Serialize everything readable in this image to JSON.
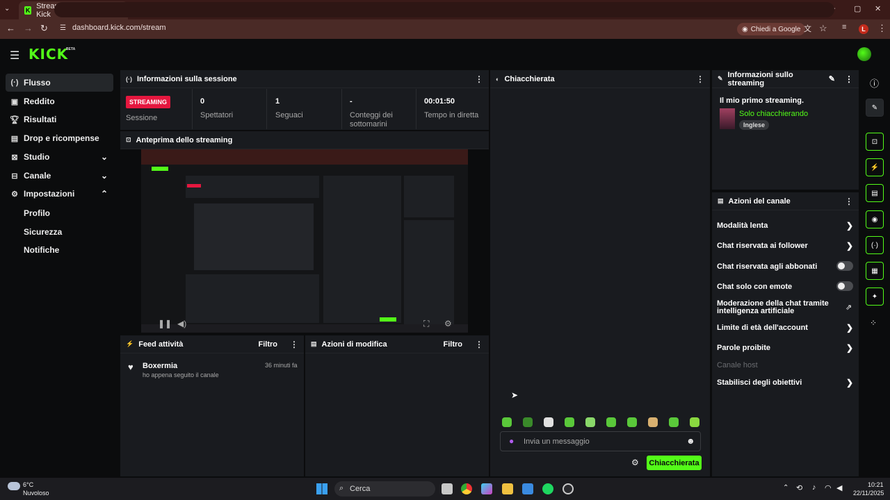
{
  "browser": {
    "tab_title": "Stream - Dashboard di Kick",
    "tab_close": "✕",
    "new_tab": "+",
    "url": "dashboard.kick.com/stream",
    "ask_google": "Chiedi a Google",
    "profile_initial": "L",
    "window_controls": [
      "–",
      "▢",
      "✕"
    ]
  },
  "kick": {
    "logo": "KICK",
    "beta": "BETA"
  },
  "sidebar": {
    "items": [
      {
        "label": "Flusso",
        "icon": "broadcast-icon"
      },
      {
        "label": "Reddito",
        "icon": "wallet-icon"
      },
      {
        "label": "Risultati",
        "icon": "trophy-icon"
      },
      {
        "label": "Drop e ricompense",
        "icon": "gift-icon"
      },
      {
        "label": "Studio",
        "icon": "studio-icon"
      },
      {
        "label": "Canale",
        "icon": "channel-icon"
      },
      {
        "label": "Impostazioni",
        "icon": "gear-icon"
      }
    ],
    "sub_items": [
      "Profilo",
      "Sicurezza",
      "Notifiche"
    ]
  },
  "session": {
    "title": "Informazioni sulla sessione",
    "badge": "STREAMING",
    "badge_label": "Sessione",
    "stats": [
      {
        "value": "0",
        "label": "Spettatori"
      },
      {
        "value": "1",
        "label": "Seguaci"
      },
      {
        "value": "-",
        "label": "Conteggi dei sottomarini"
      },
      {
        "value": "00:01:50",
        "label": "Tempo in diretta"
      }
    ]
  },
  "preview": {
    "title": "Anteprima dello streaming"
  },
  "feed": {
    "title": "Feed attività",
    "filter": "Filtro",
    "items": [
      {
        "user": "Boxermia",
        "time": "36 minuti fa",
        "text": "ho appena seguito il canale"
      }
    ]
  },
  "mod": {
    "title": "Azioni di modifica",
    "filter": "Filtro"
  },
  "chat": {
    "title": "Chiacchierata",
    "placeholder": "Invia un messaggio",
    "send": "Chiacchierata"
  },
  "stream_info": {
    "title": "Informazioni sullo streaming",
    "stream_title": "Il mio primo streaming.",
    "category": "Solo chiacchierando",
    "language": "Inglese"
  },
  "channel_actions": {
    "title": "Azioni del canale",
    "items": [
      {
        "label": "Modalità lenta",
        "control": "chevron"
      },
      {
        "label": "Chat riservata ai follower",
        "control": "chevron"
      },
      {
        "label": "Chat riservata agli abbonati",
        "control": "toggle"
      },
      {
        "label": "Chat solo con emote",
        "control": "toggle"
      },
      {
        "label": "Moderazione della chat tramite intelligenza artificiale",
        "control": "external"
      },
      {
        "label": "Limite di età dell'account",
        "control": "chevron"
      },
      {
        "label": "Parole proibite",
        "control": "chevron"
      },
      {
        "label": "Canale host",
        "control": "none"
      },
      {
        "label": "Stabilisci degli obiettivi",
        "control": "chevron"
      }
    ]
  },
  "taskbar": {
    "weather_temp": "6°C",
    "weather_desc": "Nuvoloso",
    "search": "Cerca",
    "time": "10:21",
    "date": "22/11/2025"
  },
  "colors": {
    "accent": "#53fc18",
    "live_red": "#e5173f",
    "panel": "#191b1f"
  }
}
